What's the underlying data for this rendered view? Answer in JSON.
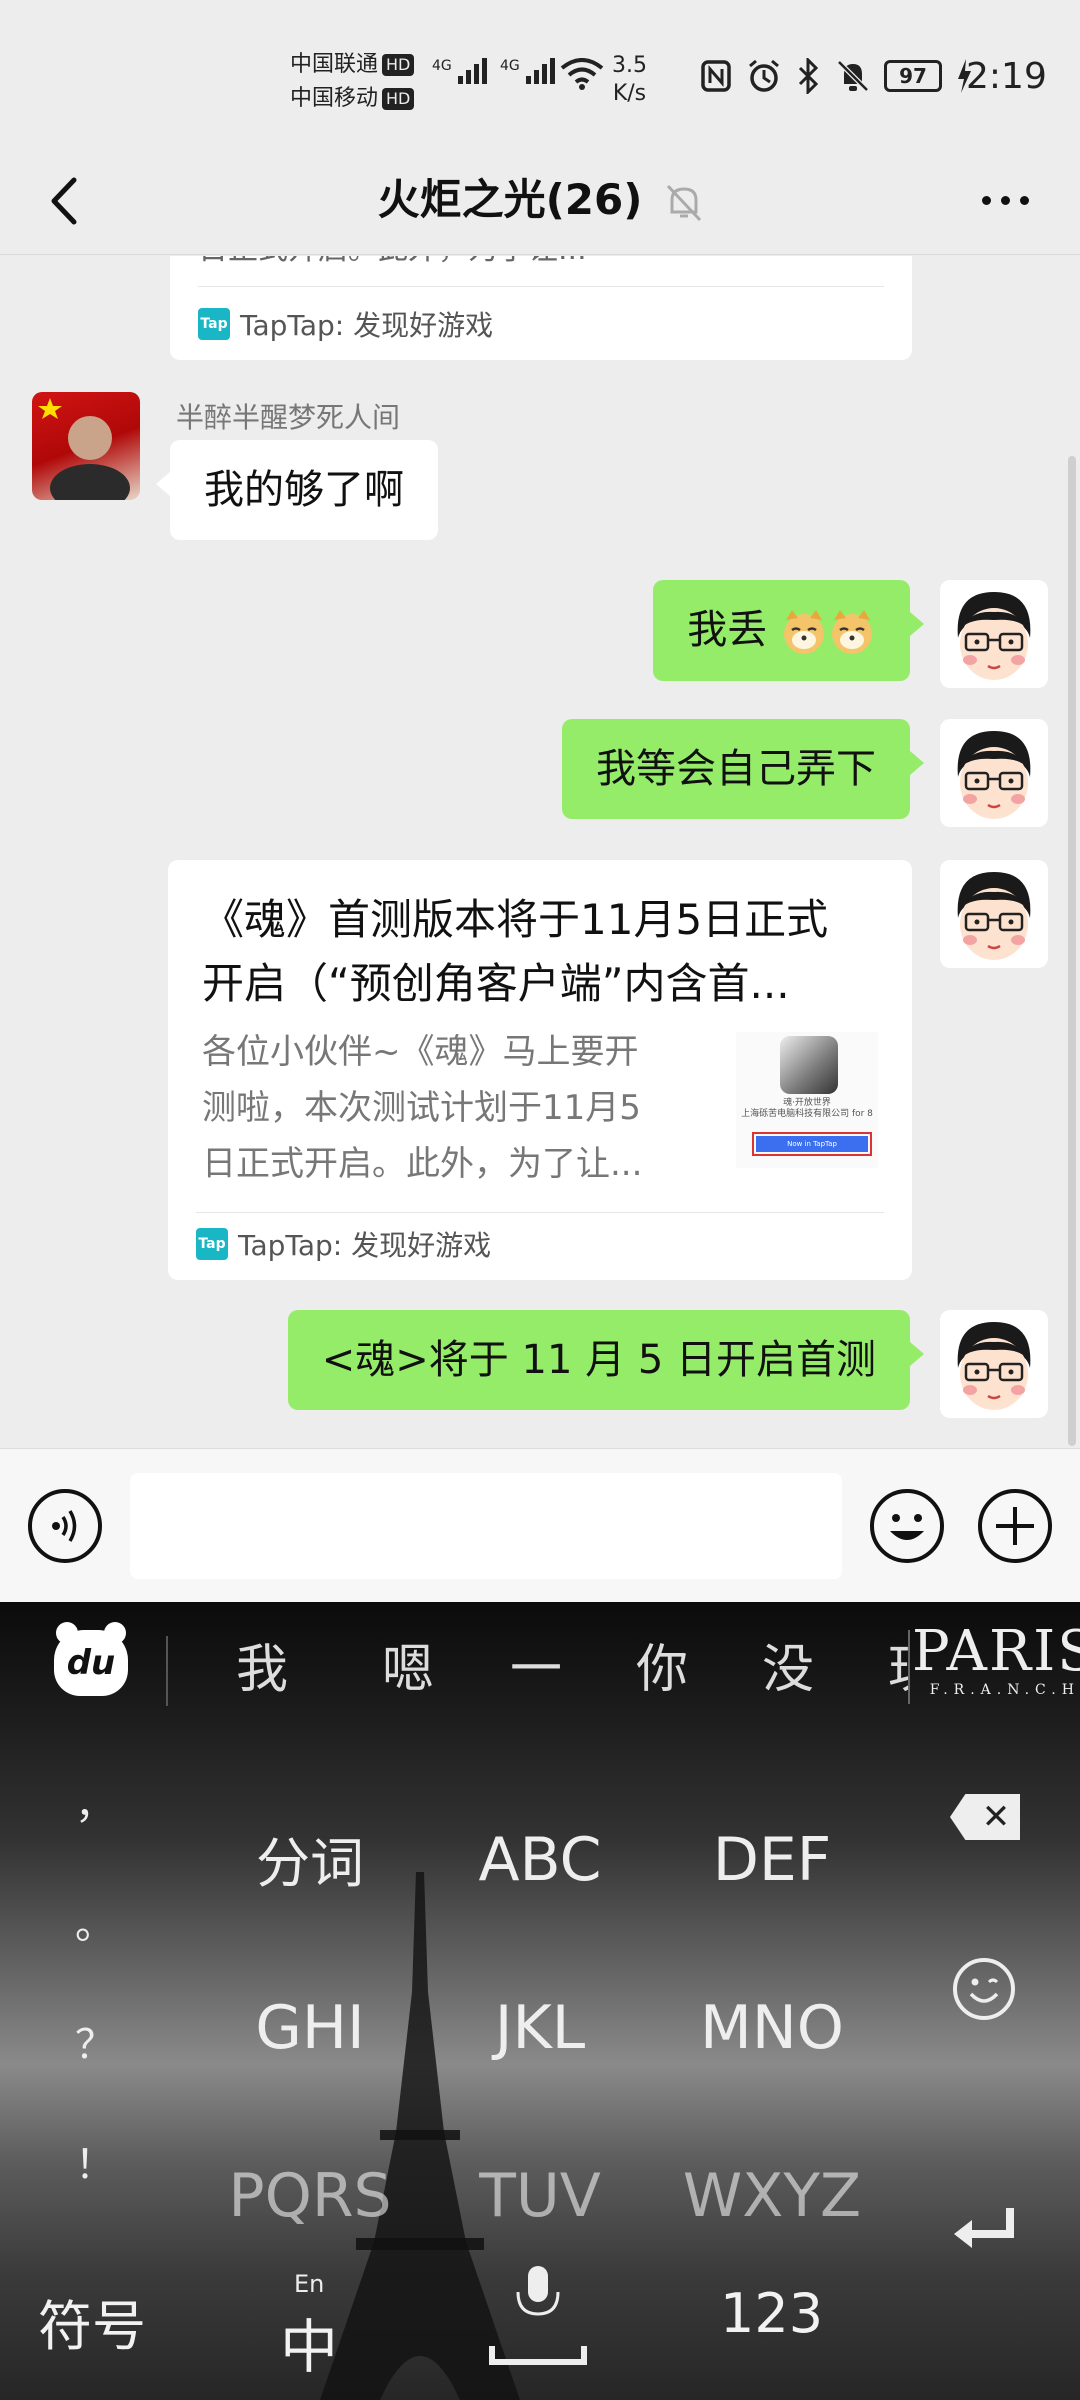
{
  "status_bar": {
    "carrier1": "中国联通",
    "carrier2": "中国移动",
    "hd": "HD",
    "net1": "4G",
    "net2": "4G",
    "speed_value": "3.5",
    "speed_unit": "K/s",
    "battery": "97",
    "time": "2:19",
    "icons": [
      "nfc-icon",
      "alarm-icon",
      "bluetooth-icon",
      "mute-icon",
      "charging-icon"
    ]
  },
  "header": {
    "title": "火炬之光(26)",
    "back_icon": "chevron-left-icon",
    "muted_icon": "bell-off-icon",
    "more_icon": "more-dots-icon"
  },
  "messages": [
    {
      "type": "card-partial",
      "source": "TapTap: 发现好游戏",
      "snippet": "日正式开启。此外，为了让..."
    },
    {
      "type": "text",
      "side": "left",
      "sender": "半醉半醒梦死人间",
      "text": "我的够了啊"
    },
    {
      "type": "text",
      "side": "right",
      "text": "我丢",
      "emoji": [
        "doge-emoji",
        "doge-emoji"
      ]
    },
    {
      "type": "text",
      "side": "right",
      "text": "我等会自己弄下"
    },
    {
      "type": "card",
      "side": "right",
      "title_line1": "《魂》首测版本将于11月5日正式",
      "title_line2": "开启（“预创角客户端”内含首...",
      "desc_line1": "各位小伙伴~《魂》马上要开",
      "desc_line2": "测啦，本次测试计划于11月5",
      "desc_line3": "日正式开启。此外，为了让...",
      "thumb_caption1": "魂·开放世界",
      "thumb_caption2": "上海砾苦电脑科技有限公司 for 8",
      "thumb_button": "Now in TapTap",
      "source": "TapTap: 发现好游戏"
    },
    {
      "type": "text",
      "side": "right",
      "text": "<魂>将于 11 月 5 日开启首测"
    }
  ],
  "input_bar": {
    "voice_icon": "voice-icon",
    "emoji_icon": "emoji-icon",
    "plus_icon": "plus-icon",
    "text": ""
  },
  "keyboard": {
    "logo": "du",
    "candidates": [
      "我",
      "嗯",
      "一",
      "你",
      "没",
      "玩"
    ],
    "theme_title": "PARIS",
    "theme_sub": "F.R.A.N.C.H",
    "punctuation": [
      "，",
      "。",
      "？",
      "！"
    ],
    "rows": [
      [
        "分词",
        "ABC",
        "DEF"
      ],
      [
        "GHI",
        "JKL",
        "MNO"
      ],
      [
        "PQRS",
        "TUV",
        "WXYZ"
      ]
    ],
    "symbols": "符号",
    "lang_top": "En",
    "lang_main": "中",
    "num": "123",
    "backspace_icon": "backspace-icon",
    "smiley_icon": "smiley-icon",
    "enter_icon": "enter-icon",
    "mic_icon": "microphone-icon"
  }
}
